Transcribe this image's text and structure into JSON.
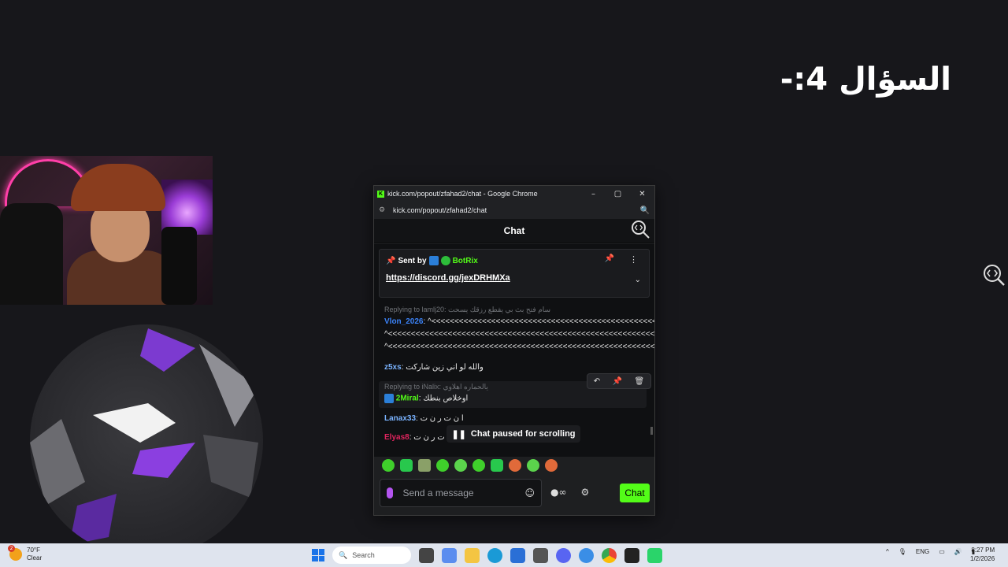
{
  "slide": {
    "question_title": "السؤال 4:-"
  },
  "browser": {
    "window_title": "kick.com/popout/zfahad2/chat - Google Chrome",
    "url": "kick.com/popout/zfahad2/chat",
    "minimize": "–",
    "maximize": "▢",
    "close": "✕"
  },
  "chat": {
    "header": "Chat",
    "pinned": {
      "sent_by_label": "Sent by",
      "bot_name": "BotRix",
      "link_text": "https://discord.gg/jexDRHMXa"
    },
    "messages": [
      {
        "reply_to": "Replying to lamlj20: سام فتح بث بي يقطع رزقك يسحت",
        "user": "Vlon_2026",
        "text": "^<<<<<<<<<<<<<<<<<<<<<<<<<<<<<<<<<<<<<<<<<<<<<<<<<<<<<<<<<<<<<<<<<<<<<<<<<<<<<<<<<<<<<<<"
      },
      {
        "continuation1": "^<<<<<<<<<<<<<<<<<<<<<<<<<<<<<<<<<<<<<<<<<<<<<<<<<<<<<<<<<<<<<<<<<<<<<<<<<<<<<<<<<",
        "continuation2": "^<<<<<<<<<<<<<<<<<<<<<<<<<<<<<<<<<<<<<<<<<<<<<<<<<<<<<<<<<<<<<<<<<<<<<<<<<<<<<<<<<"
      },
      {
        "user": "z5xs",
        "text": "والله لو اني زين شاركت"
      },
      {
        "reply_to": "Replying to iNalix: يالحماره اهلاوي",
        "user": "2Miral",
        "text": "اوخلاص بنطك"
      },
      {
        "user": "Lanax33",
        "text": "ا ن ت ر ن ت"
      },
      {
        "user": "Elyas8",
        "text": "ا ن ت ر ن ت"
      }
    ],
    "paused_text": "Chat paused for scrolling",
    "input_placeholder": "Send a message",
    "send_label": "Chat"
  },
  "taskbar": {
    "weather_temp": "70°F",
    "weather_cond": "Clear",
    "weather_alert": "2",
    "search_placeholder": "Search",
    "lang": "ENG",
    "time": "8:27 PM",
    "date": "1/2/2026"
  },
  "colors": {
    "kick_green": "#53fc18",
    "bg": "#17171b",
    "mod_badge": "#2b7fd8"
  }
}
